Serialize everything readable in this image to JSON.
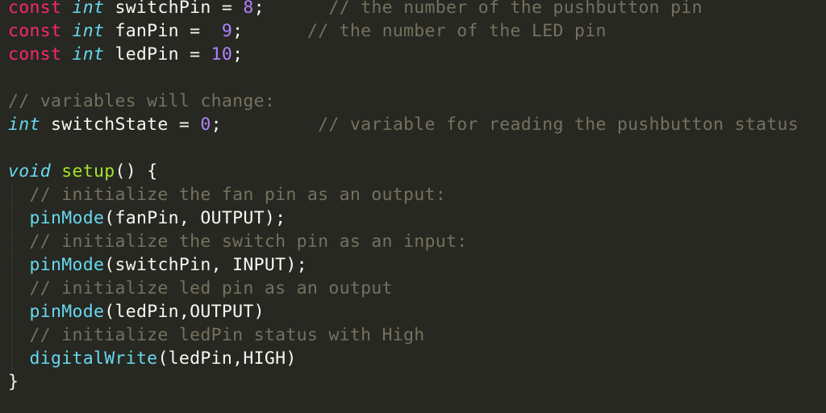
{
  "colors": {
    "background": "#272822",
    "keyword": "#f92672",
    "type": "#66d9ef",
    "identifier": "#f8f8f2",
    "number": "#ae81ff",
    "comment": "#75715e",
    "function": "#a6e22e",
    "call": "#66d9ef"
  },
  "code_lines": [
    [
      {
        "text": "const ",
        "kind": "keyword"
      },
      {
        "text": "int",
        "kind": "type"
      },
      {
        "text": " switchPin = ",
        "kind": "identifier"
      },
      {
        "text": "8",
        "kind": "number"
      },
      {
        "text": ";      ",
        "kind": "identifier"
      },
      {
        "text": "// the number of the pushbutton pin",
        "kind": "comment"
      }
    ],
    [
      {
        "text": "const ",
        "kind": "keyword"
      },
      {
        "text": "int",
        "kind": "type"
      },
      {
        "text": " fanPin =  ",
        "kind": "identifier"
      },
      {
        "text": "9",
        "kind": "number"
      },
      {
        "text": ";      ",
        "kind": "identifier"
      },
      {
        "text": "// the number of the LED pin",
        "kind": "comment"
      }
    ],
    [
      {
        "text": "const ",
        "kind": "keyword"
      },
      {
        "text": "int",
        "kind": "type"
      },
      {
        "text": " ledPin = ",
        "kind": "identifier"
      },
      {
        "text": "10",
        "kind": "number"
      },
      {
        "text": ";",
        "kind": "identifier"
      }
    ],
    [],
    [
      {
        "text": "// variables will change:",
        "kind": "comment"
      }
    ],
    [
      {
        "text": "int",
        "kind": "type"
      },
      {
        "text": " switchState = ",
        "kind": "identifier"
      },
      {
        "text": "0",
        "kind": "number"
      },
      {
        "text": ";         ",
        "kind": "identifier"
      },
      {
        "text": "// variable for reading the pushbutton status",
        "kind": "comment"
      }
    ],
    [],
    [
      {
        "text": "void",
        "kind": "type"
      },
      {
        "text": " ",
        "kind": "identifier"
      },
      {
        "text": "setup",
        "kind": "function"
      },
      {
        "text": "() {",
        "kind": "identifier"
      }
    ],
    [
      {
        "text": "  ",
        "kind": "identifier"
      },
      {
        "text": "// initialize the fan pin as an output:",
        "kind": "comment"
      }
    ],
    [
      {
        "text": "  ",
        "kind": "identifier"
      },
      {
        "text": "pinMode",
        "kind": "call"
      },
      {
        "text": "(fanPin, OUTPUT);",
        "kind": "identifier"
      }
    ],
    [
      {
        "text": "  ",
        "kind": "identifier"
      },
      {
        "text": "// initialize the switch pin as an input:",
        "kind": "comment"
      }
    ],
    [
      {
        "text": "  ",
        "kind": "identifier"
      },
      {
        "text": "pinMode",
        "kind": "call"
      },
      {
        "text": "(switchPin, INPUT);",
        "kind": "identifier"
      }
    ],
    [
      {
        "text": "  ",
        "kind": "identifier"
      },
      {
        "text": "// initialize led pin as an output",
        "kind": "comment"
      }
    ],
    [
      {
        "text": "  ",
        "kind": "identifier"
      },
      {
        "text": "pinMode",
        "kind": "call"
      },
      {
        "text": "(ledPin,OUTPUT)",
        "kind": "identifier"
      }
    ],
    [
      {
        "text": "  ",
        "kind": "identifier"
      },
      {
        "text": "// initialize ledPin status with High",
        "kind": "comment"
      }
    ],
    [
      {
        "text": "  ",
        "kind": "identifier"
      },
      {
        "text": "digitalWrite",
        "kind": "call"
      },
      {
        "text": "(ledPin,HIGH)",
        "kind": "identifier"
      }
    ],
    [
      {
        "text": "}",
        "kind": "identifier"
      }
    ]
  ]
}
